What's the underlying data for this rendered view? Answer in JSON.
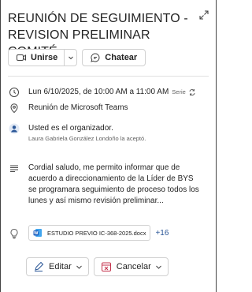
{
  "event": {
    "title": "REUNIÓN DE SEGUIMIENTO - REVISION PRELIMINAR COMITÉ",
    "actions": {
      "join_label": "Unirse",
      "chat_label": "Chatear"
    },
    "datetime": "Lun 6/10/2025, de 10:00 AM a 11:00 AM",
    "series_label": "Serie",
    "location": "Reunión de Microsoft Teams",
    "organizer": {
      "line": "Usted es el organizador.",
      "accepted": "Laura Gabriela González Londoño la aceptó."
    },
    "description": "Cordial saludo, me permito informar que de acuerdo a direccionamiento de la Líder de BYS se programara seguimiento de proceso todos los lunes y así mismo revisión preliminar...",
    "attachment": {
      "file_name": "ESTUDIO PREVIO IC-368-2025.docx",
      "more_count": "+16"
    }
  },
  "footer": {
    "edit_label": "Editar",
    "cancel_label": "Cancelar"
  },
  "colors": {
    "accent": "#2b5797",
    "cancel_red": "#c4314b",
    "word_blue": "#185abd"
  },
  "icons": [
    "expand-icon",
    "video-icon",
    "chevron-down-icon",
    "chat-icon",
    "clock-icon",
    "recurrence-icon",
    "location-icon",
    "organizer-avatar-icon",
    "notes-icon",
    "lightbulb-icon",
    "word-doc-icon",
    "pencil-icon",
    "cancel-calendar-icon"
  ]
}
